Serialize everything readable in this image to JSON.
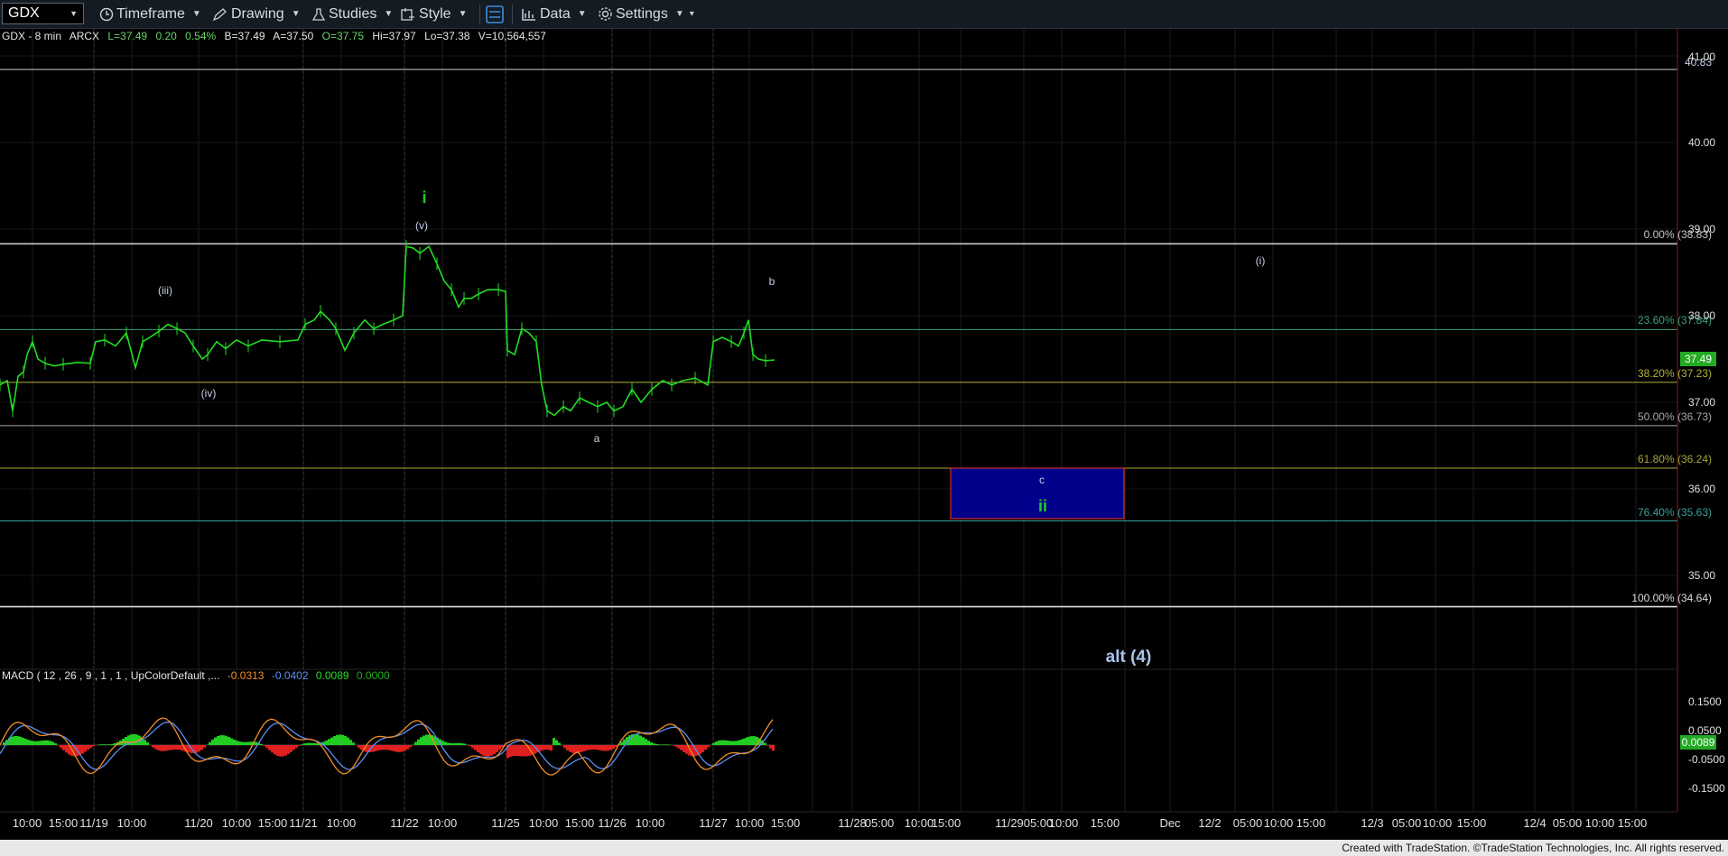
{
  "toolbar": {
    "symbol": "GDX",
    "timeframe_label": "Timeframe",
    "drawing_label": "Drawing",
    "studies_label": "Studies",
    "style_label": "Style",
    "data_label": "Data",
    "settings_label": "Settings",
    "icons": [
      "clock-icon",
      "pencil-icon",
      "flask-icon",
      "style-icon",
      "layout-icon",
      "bar-chart-icon",
      "gear-icon"
    ]
  },
  "infoline": {
    "title": "GDX - 8 min",
    "exchange": "ARCX",
    "last": "L=37.49",
    "change": "0.20",
    "change_pct": "0.54%",
    "bid": "B=37.49",
    "ask": "A=37.50",
    "open": "O=37.75",
    "high": "Hi=37.97",
    "low": "Lo=37.38",
    "volume": "V=10,564,557"
  },
  "price_axis": {
    "ticks": [
      "41.00",
      "40.00",
      "39.00",
      "38.00",
      "37.00",
      "36.00",
      "35.00"
    ],
    "last_price": "37.49",
    "level_label": "40.83"
  },
  "fib_levels": [
    {
      "label": "0.00% (38.83)",
      "value": 38.83,
      "color": "#c8c8c8"
    },
    {
      "label": "23.60% (37.84)",
      "value": 37.84,
      "color": "#3aa07a"
    },
    {
      "label": "38.20% (37.23)",
      "value": 37.23,
      "color": "#b5b23a"
    },
    {
      "label": "50.00% (36.73)",
      "value": 36.73,
      "color": "#a8a8a8"
    },
    {
      "label": "61.80% (36.24)",
      "value": 36.24,
      "color": "#a8a83a"
    },
    {
      "label": "76.40% (35.63)",
      "value": 35.63,
      "color": "#3aa09a"
    },
    {
      "label": "100.00% (34.64)",
      "value": 34.64,
      "color": "#dcdcdc"
    }
  ],
  "wave_labels": {
    "i": "i",
    "v": "(v)",
    "iii": "(iii)",
    "iv": "(iv)",
    "a": "a",
    "b": "b",
    "c": "c",
    "ii": "ii",
    "wave_i": "(i)",
    "alt4": "alt (4)"
  },
  "target_box": {
    "top": 36.24,
    "bottom": 35.63,
    "fill": "#00008b",
    "border": "#d03030"
  },
  "macd": {
    "name": "MACD ( 12 , 26 , 9 , 1 , 1 , UpColorDefault ,...",
    "v1": "-0.0313",
    "v2": "-0.0402",
    "v3": "0.0089",
    "v4": "0.0000",
    "ticks": [
      "0.1500",
      "0.0500",
      "-0.0500",
      "-0.1500"
    ],
    "last_value": "0.0089"
  },
  "time_axis": {
    "ticks": [
      "10:00",
      "15:00",
      "11/19",
      "10:00",
      "11/20",
      "10:00",
      "15:00",
      "11/21",
      "10:00",
      "11/22",
      "10:00",
      "11/25",
      "10:00",
      "15:00",
      "11/26",
      "10:00",
      "11/27",
      "10:00",
      "15:00",
      "11/28",
      "05:00",
      "10:00",
      "15:00",
      "11/29",
      "05:00",
      "10:00",
      "15:00",
      "Dec",
      "12/2",
      "05:00",
      "10:00",
      "15:00",
      "12/3",
      "05:00",
      "10:00",
      "15:00",
      "12/4",
      "05:00",
      "10:00",
      "15:00"
    ]
  },
  "footer": "Created with TradeStation. ©TradeStation Technologies, Inc. All rights reserved.",
  "colors": {
    "price_line": "#22dd22",
    "macd_line": "#f08c28",
    "signal_line": "#5b8ef0",
    "hist_up": "#22cc22",
    "hist_down": "#e02020"
  }
}
